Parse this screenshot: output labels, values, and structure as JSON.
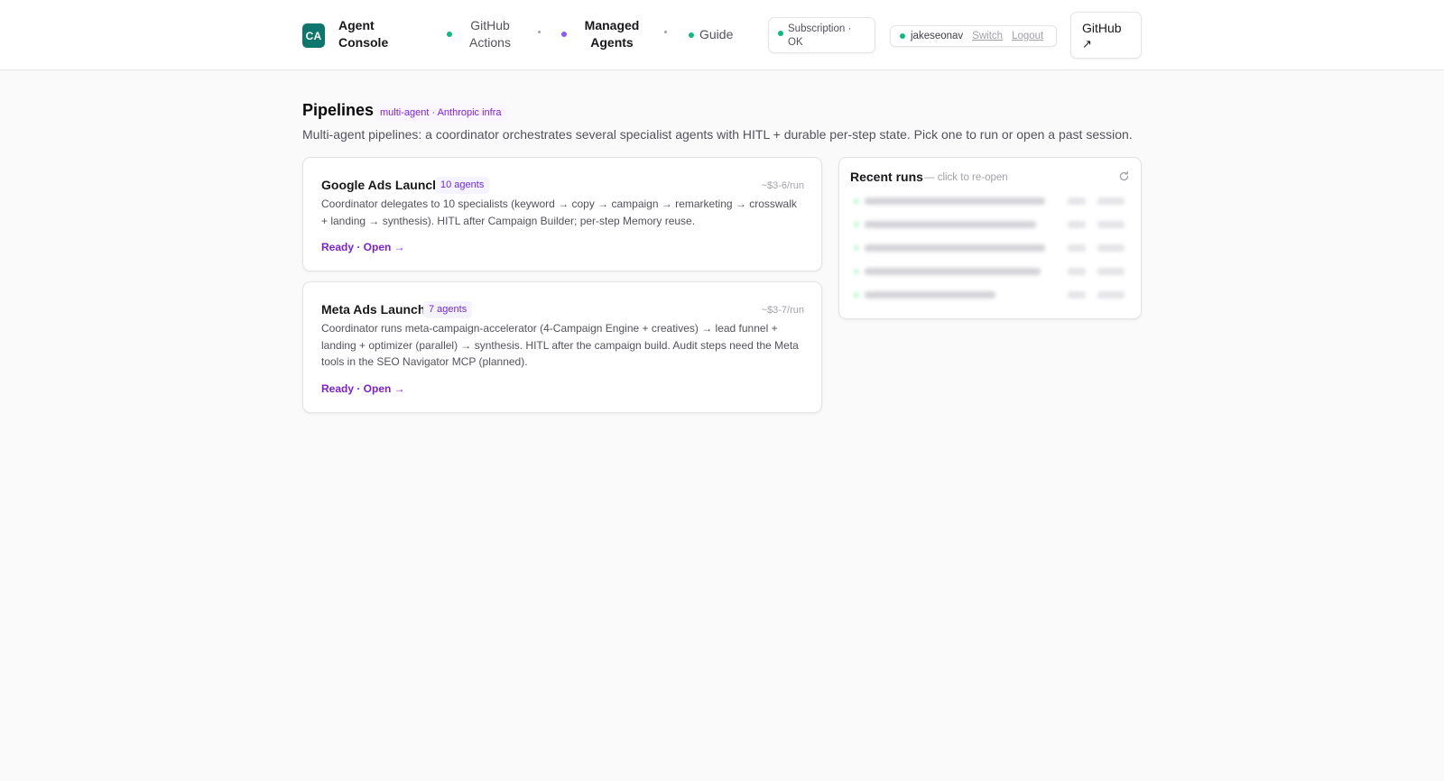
{
  "header": {
    "logo_text": "CA",
    "brand": "Agent Console",
    "nav": [
      {
        "label": "GitHub Actions",
        "dot_color": "#10b981",
        "active": false
      },
      {
        "label": "Managed Agents",
        "dot_color": "#8b5cf6",
        "active": true
      },
      {
        "label": "Guide",
        "dot_color": "#10b981",
        "active": false
      }
    ],
    "subscription_status": "Subscription · OK",
    "user": {
      "name": "jakeseonav",
      "switch_label": "Switch",
      "logout_label": "Logout"
    },
    "github_button": {
      "label": "GitHub",
      "arrow": "↗"
    }
  },
  "page": {
    "title": "Pipelines",
    "tag": "multi-agent · Anthropic infra",
    "subtitle": "Multi-agent pipelines: a coordinator orchestrates several specialist agents with HITL + durable per-step state. Pick one to run or open a past session."
  },
  "pipelines": [
    {
      "title": "Google Ads Launch",
      "badge": "10 agents",
      "cost": "~$3-6/run",
      "description": "Coordinator delegates to 10 specialists (keyword → copy → campaign → remarketing → crosswalk + landing → synthesis). HITL after Campaign Builder; per-step Memory reuse.",
      "action": "Ready · Open →"
    },
    {
      "title": "Meta Ads Launch",
      "badge": "7 agents",
      "cost": "~$3-7/run",
      "description": "Coordinator runs meta-campaign-accelerator (4-Campaign Engine + creatives) → lead funnel + landing + optimizer (parallel) → synthesis. HITL after the campaign build. Audit steps need the Meta tools in the SEO Navigator MCP (planned).",
      "action": "Ready · Open →"
    }
  ],
  "recent_runs": {
    "title": "Recent runs",
    "hint": "— click to re-open",
    "icon": "refresh-icon"
  },
  "colors": {
    "accent_purple": "#7e22ce",
    "brand_teal": "#0f766e",
    "status_green": "#10b981"
  }
}
